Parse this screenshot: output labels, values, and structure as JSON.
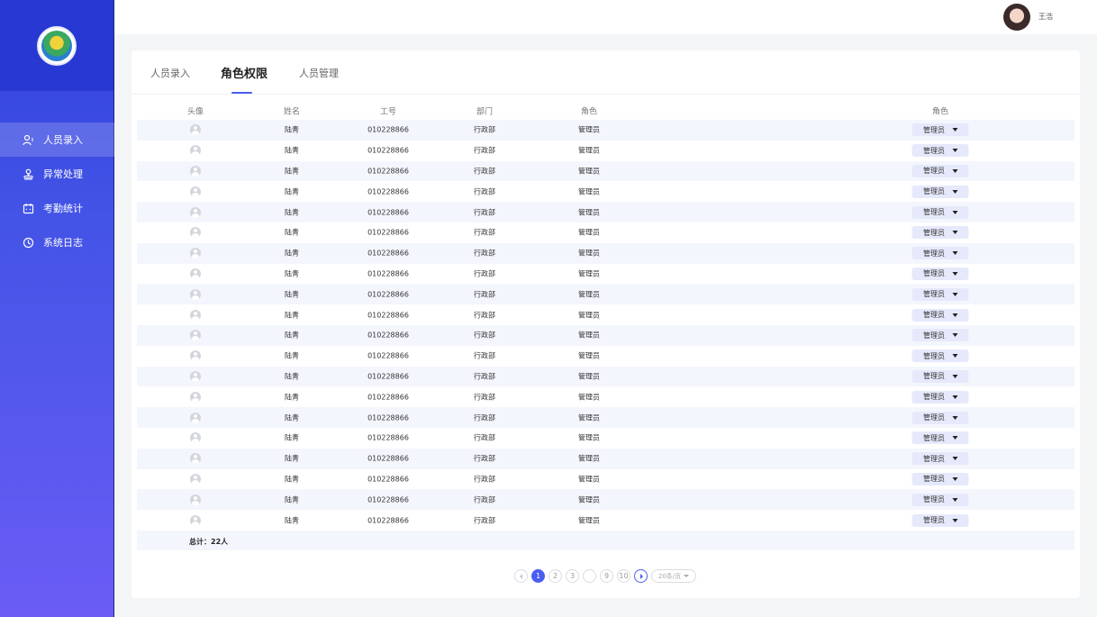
{
  "header": {
    "username": "王浩"
  },
  "sidebar": {
    "items": [
      {
        "label": "人员录入",
        "icon": "person-icon",
        "active": true
      },
      {
        "label": "异常处理",
        "icon": "stamp-icon",
        "active": false
      },
      {
        "label": "考勤统计",
        "icon": "calendar-icon",
        "active": false
      },
      {
        "label": "系统日志",
        "icon": "clock-icon",
        "active": false
      }
    ]
  },
  "tabs": [
    {
      "label": "人员录入",
      "active": false
    },
    {
      "label": "角色权限",
      "active": true
    },
    {
      "label": "人员管理",
      "active": false
    }
  ],
  "table": {
    "columns": [
      "头像",
      "姓名",
      "工号",
      "部门",
      "角色",
      "角色"
    ],
    "rows": [
      {
        "name": "陆青",
        "id": "010228866",
        "dept": "行政部",
        "role": "管理员",
        "role_select": "管理员"
      },
      {
        "name": "陆青",
        "id": "010228866",
        "dept": "行政部",
        "role": "管理员",
        "role_select": "管理员"
      },
      {
        "name": "陆青",
        "id": "010228866",
        "dept": "行政部",
        "role": "管理员",
        "role_select": "管理员"
      },
      {
        "name": "陆青",
        "id": "010228866",
        "dept": "行政部",
        "role": "管理员",
        "role_select": "管理员"
      },
      {
        "name": "陆青",
        "id": "010228866",
        "dept": "行政部",
        "role": "管理员",
        "role_select": "管理员"
      },
      {
        "name": "陆青",
        "id": "010228866",
        "dept": "行政部",
        "role": "管理员",
        "role_select": "管理员"
      },
      {
        "name": "陆青",
        "id": "010228866",
        "dept": "行政部",
        "role": "管理员",
        "role_select": "管理员"
      },
      {
        "name": "陆青",
        "id": "010228866",
        "dept": "行政部",
        "role": "管理员",
        "role_select": "管理员"
      },
      {
        "name": "陆青",
        "id": "010228866",
        "dept": "行政部",
        "role": "管理员",
        "role_select": "管理员"
      },
      {
        "name": "陆青",
        "id": "010228866",
        "dept": "行政部",
        "role": "管理员",
        "role_select": "管理员"
      },
      {
        "name": "陆青",
        "id": "010228866",
        "dept": "行政部",
        "role": "管理员",
        "role_select": "管理员"
      },
      {
        "name": "陆青",
        "id": "010228866",
        "dept": "行政部",
        "role": "管理员",
        "role_select": "管理员"
      },
      {
        "name": "陆青",
        "id": "010228866",
        "dept": "行政部",
        "role": "管理员",
        "role_select": "管理员"
      },
      {
        "name": "陆青",
        "id": "010228866",
        "dept": "行政部",
        "role": "管理员",
        "role_select": "管理员"
      },
      {
        "name": "陆青",
        "id": "010228866",
        "dept": "行政部",
        "role": "管理员",
        "role_select": "管理员"
      },
      {
        "name": "陆青",
        "id": "010228866",
        "dept": "行政部",
        "role": "管理员",
        "role_select": "管理员"
      },
      {
        "name": "陆青",
        "id": "010228866",
        "dept": "行政部",
        "role": "管理员",
        "role_select": "管理员"
      },
      {
        "name": "陆青",
        "id": "010228866",
        "dept": "行政部",
        "role": "管理员",
        "role_select": "管理员"
      },
      {
        "name": "陆青",
        "id": "010228866",
        "dept": "行政部",
        "role": "管理员",
        "role_select": "管理员"
      },
      {
        "name": "陆青",
        "id": "010228866",
        "dept": "行政部",
        "role": "管理员",
        "role_select": "管理员"
      }
    ],
    "total": "总计：22人"
  },
  "pagination": {
    "pages": [
      "1",
      "2",
      "3",
      "...",
      "9",
      "10"
    ],
    "current": "1",
    "page_size": "20条/页"
  },
  "colors": {
    "accent": "#4a5ef0",
    "sidebar_top": "#2f3fdc",
    "sidebar_bottom": "#6a5cf5",
    "row_stripe": "#f4f6fd"
  }
}
